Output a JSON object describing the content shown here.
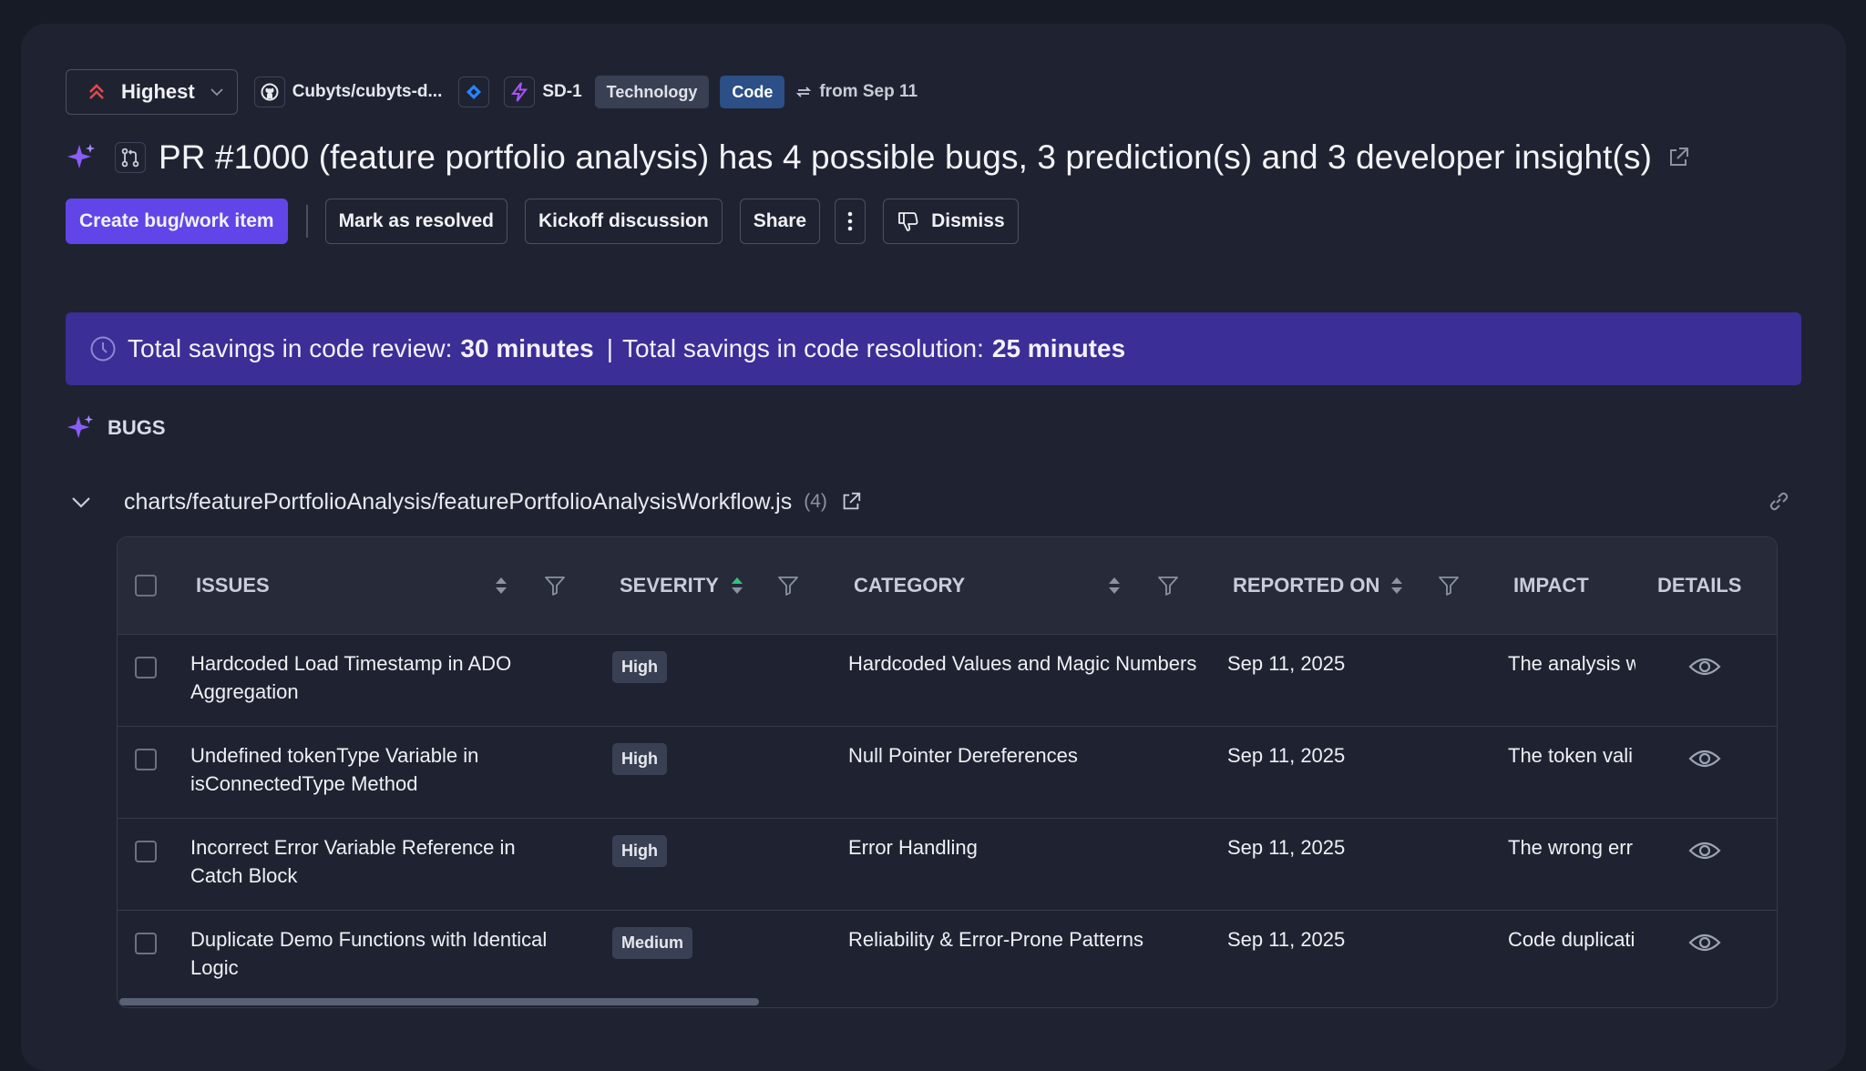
{
  "header": {
    "priority_label": "Highest",
    "repo_label": "Cubyts/cubyts-d...",
    "ticket_id": "SD-1",
    "tag_technology": "Technology",
    "tag_code": "Code",
    "from_label": "from Sep 11"
  },
  "title": {
    "text": "PR #1000 (feature portfolio analysis) has 4 possible bugs, 3 prediction(s) and 3 developer insight(s)"
  },
  "actions": {
    "create_label": "Create bug/work item",
    "resolve_label": "Mark as resolved",
    "kickoff_label": "Kickoff discussion",
    "share_label": "Share",
    "dismiss_label": "Dismiss"
  },
  "banner": {
    "review_label": "Total savings in code review:",
    "review_value": "30 minutes",
    "divider": "|",
    "resolution_label": "Total savings in code resolution:",
    "resolution_value": "25 minutes"
  },
  "bugs": {
    "section_label": "BUGS",
    "file_path": "charts/featurePortfolioAnalysis/featurePortfolioAnalysisWorkflow.js",
    "file_count": "(4)"
  },
  "table": {
    "columns": {
      "issues": "ISSUES",
      "severity": "SEVERITY",
      "category": "CATEGORY",
      "reported_on": "REPORTED ON",
      "impact": "IMPACT",
      "details": "DETAILS"
    },
    "rows": [
      {
        "issue": "Hardcoded Load Timestamp in ADO Aggregation",
        "severity": "High",
        "category": "Hardcoded Values and Magic Numbers",
        "reported_on": "Sep 11, 2025",
        "impact": "The analysis w"
      },
      {
        "issue": "Undefined tokenType Variable in isConnectedType Method",
        "severity": "High",
        "category": "Null Pointer Dereferences",
        "reported_on": "Sep 11, 2025",
        "impact": "The token vali"
      },
      {
        "issue": "Incorrect Error Variable Reference in Catch Block",
        "severity": "High",
        "category": "Error Handling",
        "reported_on": "Sep 11, 2025",
        "impact": "The wrong err"
      },
      {
        "issue": "Duplicate Demo Functions with Identical Logic",
        "severity": "Medium",
        "category": "Reliability & Error-Prone Patterns",
        "reported_on": "Sep 11, 2025",
        "impact": "Code duplicati"
      }
    ]
  },
  "colors": {
    "accent": "#6145e8",
    "banner": "#3b2e96",
    "priority_red": "#e0484f",
    "sparkle": "#8b5cf6"
  },
  "icons": [
    "double-chevron-up-icon",
    "chevron-down-icon",
    "github-icon",
    "jira-icon",
    "lightning-icon",
    "sync-icon",
    "sparkle-icon",
    "pull-request-icon",
    "external-link-icon",
    "thumbs-down-icon",
    "clock-icon",
    "link-icon",
    "sort-icon",
    "filter-icon",
    "eye-icon"
  ]
}
